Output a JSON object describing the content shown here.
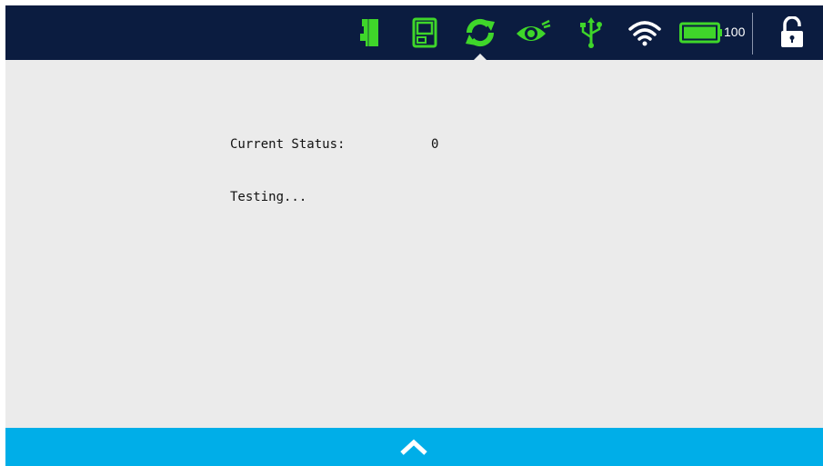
{
  "colors": {
    "topbar_bg": "#0b1c40",
    "icon_green": "#3fd62a",
    "content_bg": "#ebebeb",
    "bottombar_bg": "#00aee8"
  },
  "topbar": {
    "icons": [
      "ink-cartridge-icon",
      "printer-icon",
      "sync-icon",
      "eye-icon",
      "usb-icon",
      "wifi-icon",
      "battery-icon",
      "unlock-icon"
    ],
    "active_icon": "sync-icon",
    "battery_level": "100"
  },
  "main": {
    "status_label": "Current Status:",
    "status_value": "0",
    "message": "Testing..."
  },
  "bottombar": {
    "expand_icon": "chevron-up-icon"
  }
}
